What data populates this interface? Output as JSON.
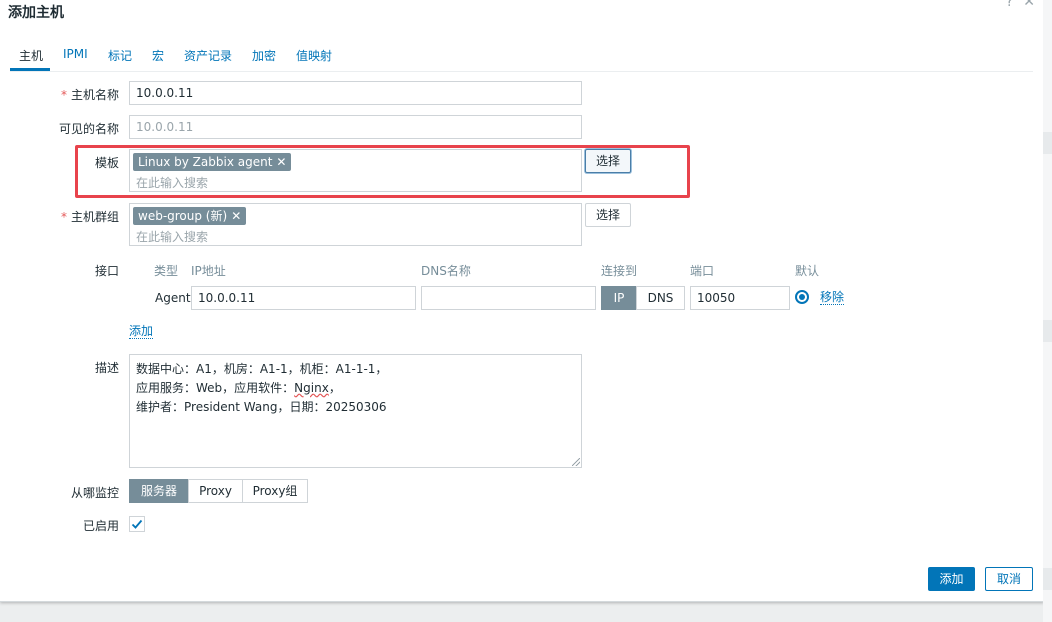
{
  "dialog": {
    "title": "添加主机"
  },
  "tabs": [
    "主机",
    "IPMI",
    "标记",
    "宏",
    "资产记录",
    "加密",
    "值映射"
  ],
  "host_name": {
    "label": "主机名称",
    "value": "10.0.0.11"
  },
  "visible_name": {
    "label": "可见的名称",
    "placeholder": "10.0.0.11"
  },
  "templates": {
    "label": "模板",
    "chip": "Linux by Zabbix agent",
    "placeholder": "在此输入搜索",
    "select_label": "选择"
  },
  "host_groups": {
    "label": "主机群组",
    "chip": "web-group (新)",
    "placeholder": "在此输入搜索",
    "select_label": "选择"
  },
  "interfaces": {
    "label": "接口",
    "headers": {
      "type": "类型",
      "ip": "IP地址",
      "dns": "DNS名称",
      "connect": "连接到",
      "port": "端口",
      "default": "默认"
    },
    "row": {
      "type": "Agent",
      "ip": "10.0.0.11",
      "dns": "",
      "connect_ip": "IP",
      "connect_dns": "DNS",
      "port": "10050",
      "remove": "移除"
    },
    "add": "添加"
  },
  "description": {
    "label": "描述",
    "lines": [
      "数据中心：A1，机房：A1-1，机柜：A1-1-1，",
      "应用服务：Web，应用软件：",
      "Nginx",
      "，",
      "维护者：President Wang，日期：20250306"
    ]
  },
  "monitored_by": {
    "label": "从哪监控",
    "options": [
      "服务器",
      "Proxy",
      "Proxy组"
    ],
    "selected": "服务器"
  },
  "enabled": {
    "label": "已启用",
    "checked": true
  },
  "footer": {
    "add": "添加",
    "cancel": "取消"
  },
  "colors": {
    "accent": "#0275b8",
    "chip": "#768d99",
    "highlight": "#e8434c",
    "required": "#e45959"
  },
  "icons": [
    "help-icon",
    "close-icon",
    "chip-remove-icon",
    "check-icon",
    "resize-grip-icon"
  ]
}
